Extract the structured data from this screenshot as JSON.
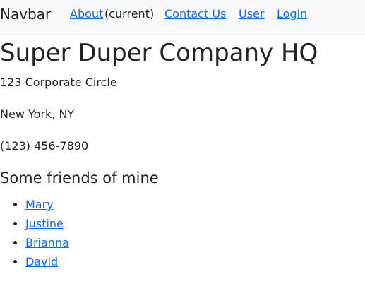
{
  "navbar": {
    "brand": "Navbar",
    "links": {
      "about": "About",
      "current_marker": "(current)",
      "contact": "Contact Us",
      "user": "User",
      "login": "Login"
    }
  },
  "main": {
    "title": "Super Duper Company HQ",
    "address_line1": "123 Corporate Circle",
    "address_line2": "New York, NY",
    "phone": "(123) 456-7890",
    "friends_heading": "Some friends of mine",
    "friends": [
      "Mary",
      "Justine",
      "Brianna",
      "David"
    ]
  },
  "colors": {
    "link": "#0d6efd",
    "text": "#212529",
    "navbar_bg": "#f8f9fa"
  }
}
